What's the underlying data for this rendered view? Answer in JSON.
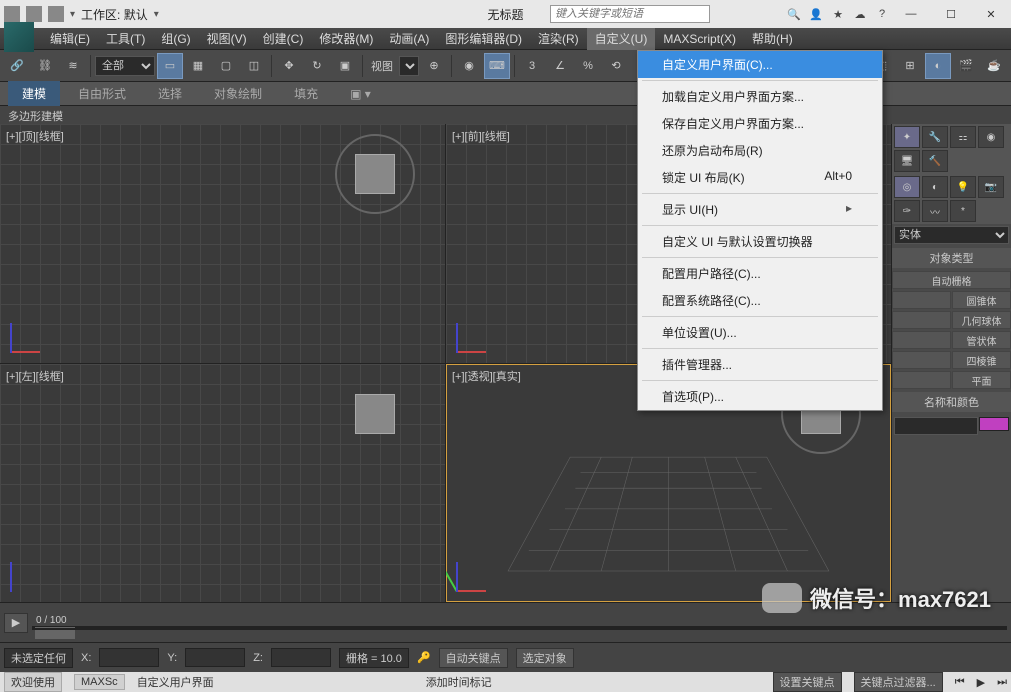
{
  "titlebar": {
    "workspace_label": "工作区: 默认",
    "title": "无标题",
    "search_placeholder": "键入关键字或短语",
    "icons": [
      "help",
      "signin",
      "favorite",
      "cloud",
      "comm"
    ]
  },
  "menubar": {
    "items": [
      "编辑(E)",
      "工具(T)",
      "组(G)",
      "视图(V)",
      "创建(C)",
      "修改器(M)",
      "动画(A)",
      "图形编辑器(D)",
      "渲染(R)",
      "自定义(U)",
      "MAXScript(X)",
      "帮助(H)"
    ],
    "active_index": 9
  },
  "toolbar": {
    "filter_label": "全部",
    "view_label": "视图"
  },
  "ribbon": {
    "tabs": [
      "建模",
      "自由形式",
      "选择",
      "对象绘制",
      "填充"
    ],
    "active_index": 0
  },
  "subheader": "多边形建模",
  "viewports": [
    {
      "label": "[+][顶][线框]",
      "axes": [
        "x",
        "z"
      ]
    },
    {
      "label": "[+][前][线框]",
      "axes": [
        "x",
        "z"
      ]
    },
    {
      "label": "[+][左][线框]",
      "axes": [
        "y",
        "z"
      ]
    },
    {
      "label": "[+][透视][真实]",
      "axes": [
        "x",
        "y",
        "z"
      ],
      "selected": true
    }
  ],
  "right_panel": {
    "dropdown": "实体",
    "header1": "对象类型",
    "autogrid": "自动栅格",
    "buttons": [
      [
        "",
        "圆锥体"
      ],
      [
        "",
        "几何球体"
      ],
      [
        "",
        "管状体"
      ],
      [
        "",
        "四棱锥"
      ],
      [
        "",
        "平面"
      ]
    ],
    "header2": "名称和颜色"
  },
  "dropdown_menu": {
    "items": [
      {
        "label": "自定义用户界面(C)...",
        "highlight": true
      },
      {
        "sep": true
      },
      {
        "label": "加载自定义用户界面方案..."
      },
      {
        "label": "保存自定义用户界面方案..."
      },
      {
        "label": "还原为启动布局(R)"
      },
      {
        "label": "锁定 UI 布局(K)",
        "shortcut": "Alt+0"
      },
      {
        "sep": true
      },
      {
        "label": "显示 UI(H)",
        "submenu": true
      },
      {
        "sep": true
      },
      {
        "label": "自定义 UI 与默认设置切换器"
      },
      {
        "sep": true
      },
      {
        "label": "配置用户路径(C)..."
      },
      {
        "label": "配置系统路径(C)..."
      },
      {
        "sep": true
      },
      {
        "label": "单位设置(U)..."
      },
      {
        "sep": true
      },
      {
        "label": "插件管理器..."
      },
      {
        "sep": true
      },
      {
        "label": "首选项(P)..."
      }
    ]
  },
  "timeline": {
    "range": "0 / 100"
  },
  "statusbar": {
    "selection": "未选定任何",
    "x": "X:",
    "y": "Y:",
    "z": "Z:",
    "grid": "栅格 = 10.0",
    "auto_key": "自动关键点",
    "selected_obj": "选定对象",
    "set_key": "设置关键点",
    "key_filter": "关键点过滤器..."
  },
  "bottombar": {
    "welcome": "欢迎使用",
    "maxscript": "MAXSc",
    "hint1": "自定义用户界面",
    "hint2": "添加时间标记"
  },
  "watermark": "微信号：max7621"
}
